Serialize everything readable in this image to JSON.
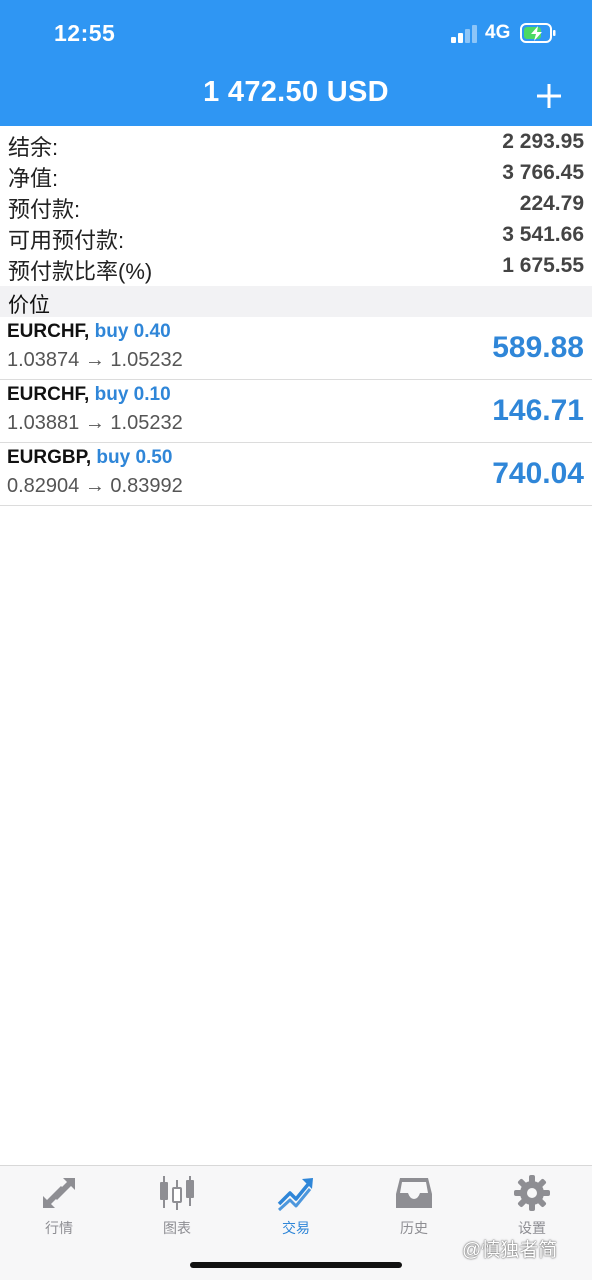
{
  "status_bar": {
    "time": "12:55",
    "network": "4G"
  },
  "header": {
    "title": "1 472.50 USD",
    "plus_icon": "plus-icon"
  },
  "account": [
    {
      "label": "结余:",
      "value": "2 293.95"
    },
    {
      "label": "净值:",
      "value": "3 766.45"
    },
    {
      "label": "预付款:",
      "value": "224.79"
    },
    {
      "label": "可用预付款:",
      "value": "3 541.66"
    },
    {
      "label": "预付款比率(%)",
      "value": "1 675.55"
    }
  ],
  "section_title": "价位",
  "positions": [
    {
      "symbol": "EURCHF,",
      "side": "buy 0.40",
      "prices": "1.03874 → 1.05232",
      "profit": "589.88"
    },
    {
      "symbol": "EURCHF,",
      "side": "buy 0.10",
      "prices": "1.03881 → 1.05232",
      "profit": "146.71"
    },
    {
      "symbol": "EURGBP,",
      "side": "buy 0.50",
      "prices": "0.82904 → 0.83992",
      "profit": "740.04"
    }
  ],
  "tabs": [
    {
      "label": "行情",
      "icon": "quotes-arrows-icon",
      "active": false
    },
    {
      "label": "图表",
      "icon": "candlestick-chart-icon",
      "active": false
    },
    {
      "label": "交易",
      "icon": "trade-trend-icon",
      "active": true
    },
    {
      "label": "历史",
      "icon": "history-inbox-icon",
      "active": false
    },
    {
      "label": "设置",
      "icon": "settings-gear-icon",
      "active": false
    }
  ],
  "watermark": "@慎独者简",
  "colors": {
    "header_bg": "#2f96f3",
    "accent": "#2f86d8"
  }
}
